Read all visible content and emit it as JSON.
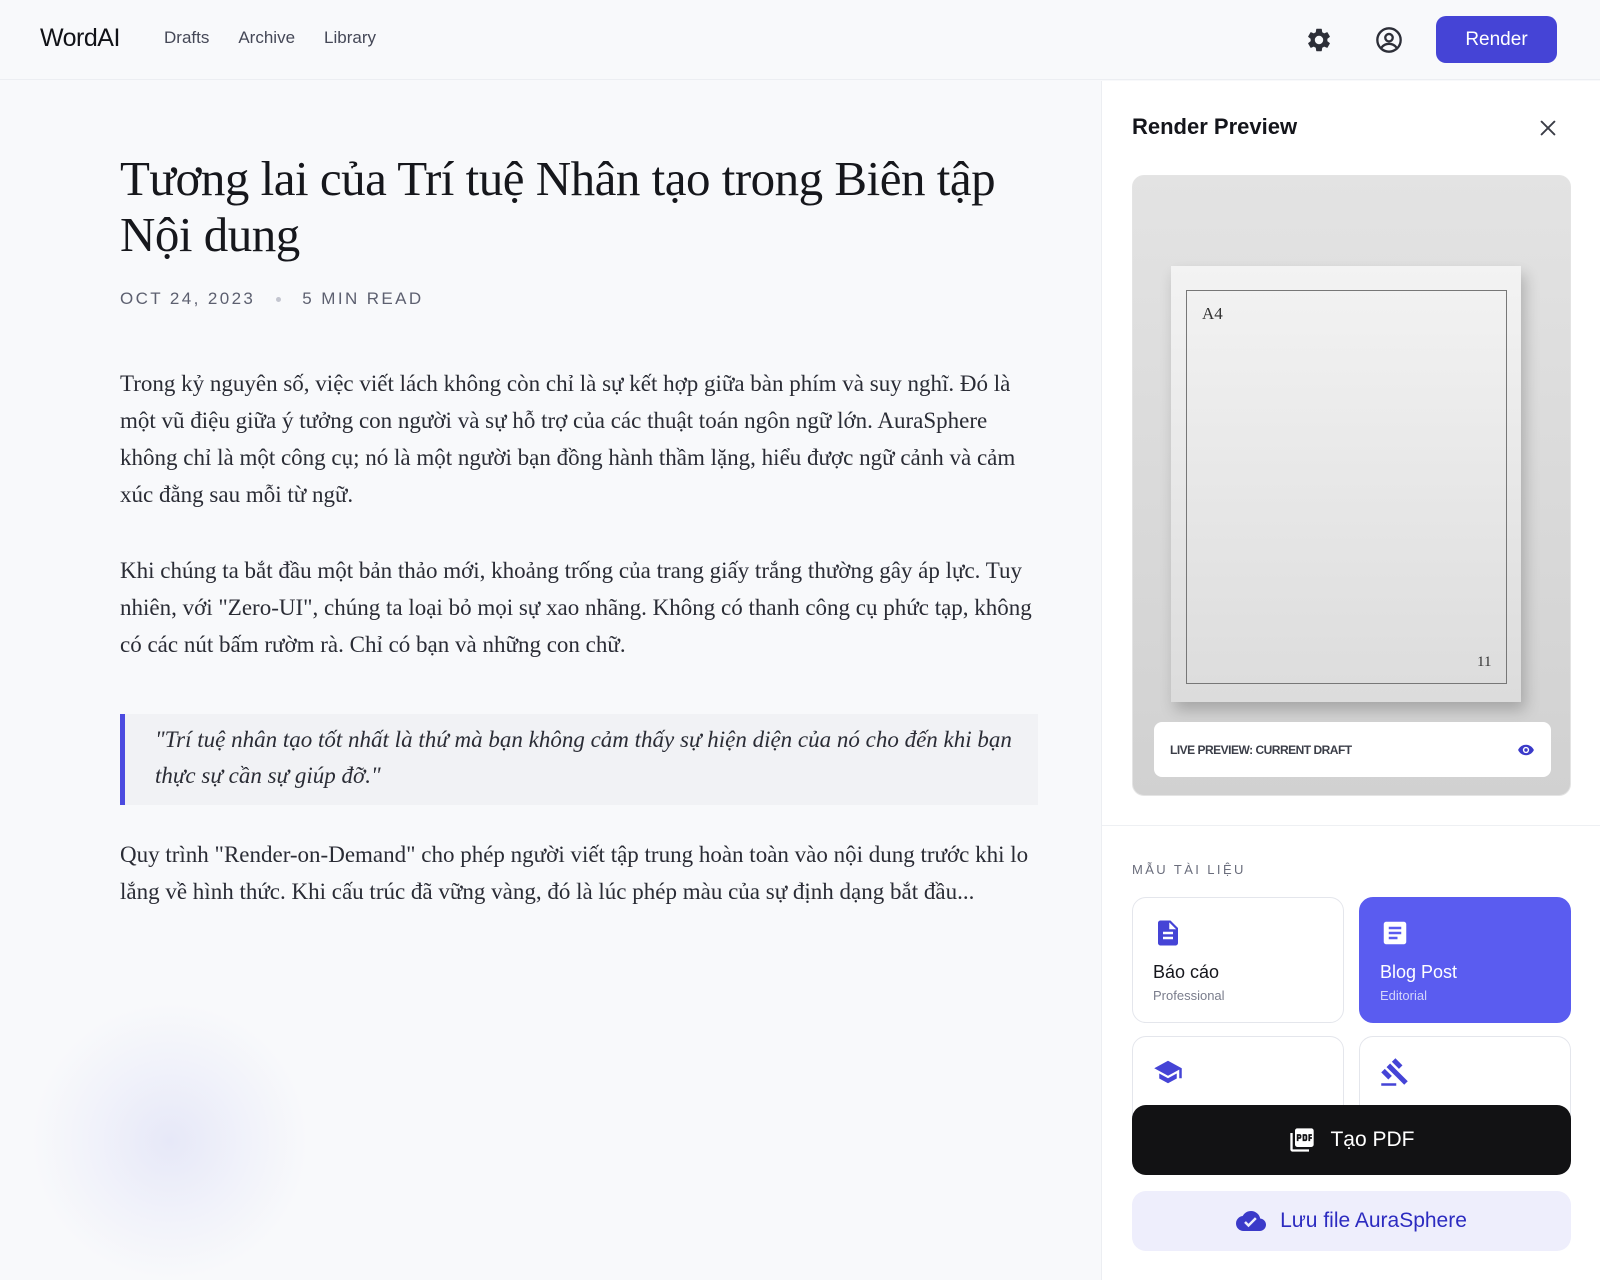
{
  "app": {
    "name": "WordAI"
  },
  "nav": {
    "items": [
      "Drafts",
      "Archive",
      "Library"
    ]
  },
  "header": {
    "settings_icon": "gear-icon",
    "account_icon": "user-circle-icon",
    "render_label": "Render"
  },
  "article": {
    "title": "Tương lai của Trí tuệ Nhân tạo trong Biên tập Nội dung",
    "date": "OCT 24, 2023",
    "read_time": "5 MIN READ",
    "paragraph_1": "Trong kỷ nguyên số, việc viết lách không còn chỉ là sự kết hợp giữa bàn phím và suy nghĩ. Đó là một vũ điệu giữa ý tưởng con người và sự hỗ trợ của các thuật toán ngôn ngữ lớn. AuraSphere không chỉ là một công cụ; nó là một người bạn đồng hành thầm lặng, hiểu được ngữ cảnh và cảm xúc đằng sau mỗi từ ngữ.",
    "paragraph_2": "Khi chúng ta bắt đầu một bản thảo mới, khoảng trống của trang giấy trắng thường gây áp lực. Tuy nhiên, với \"Zero-UI\", chúng ta loại bỏ mọi sự xao nhãng. Không có thanh công cụ phức tạp, không có các nút bấm rườm rà. Chỉ có bạn và những con chữ.",
    "quote": "\"Trí tuệ nhân tạo tốt nhất là thứ mà bạn không cảm thấy sự hiện diện của nó cho đến khi bạn thực sự cần sự giúp đỡ.\"",
    "paragraph_3": "Quy trình \"Render-on-Demand\" cho phép người viết tập trung hoàn toàn vào nội dung trước khi lo lắng về hình thức. Khi cấu trúc đã vững vàng, đó là lúc phép màu của sự định dạng bắt đầu..."
  },
  "panel": {
    "title": "Render Preview",
    "close_icon": "close-icon",
    "preview": {
      "page_size": "A4",
      "page_number": "11",
      "live_label": "LIVE PREVIEW: CURRENT DRAFT",
      "eye_icon": "eye-icon"
    },
    "templates_label": "MẪU TÀI LIỆU",
    "templates": [
      {
        "name": "Báo cáo",
        "subtitle": "Professional",
        "icon": "document-icon",
        "selected": false
      },
      {
        "name": "Blog Post",
        "subtitle": "Editorial",
        "icon": "article-icon",
        "selected": true
      },
      {
        "name": "",
        "subtitle": "",
        "icon": "graduation-cap-icon",
        "selected": false
      },
      {
        "name": "",
        "subtitle": "",
        "icon": "gavel-icon",
        "selected": false
      }
    ],
    "pdf_button": {
      "label": "Tạo PDF",
      "icon": "pdf-icon"
    },
    "save_button": {
      "label": "Lưu file AuraSphere",
      "icon": "cloud-check-icon"
    }
  },
  "colors": {
    "accent": "#4544D6",
    "template_selected": "#5A5CF0",
    "quote_border": "#4C4BE0",
    "pdf_button": "#121214",
    "save_button_bg": "#EEEEFC"
  }
}
